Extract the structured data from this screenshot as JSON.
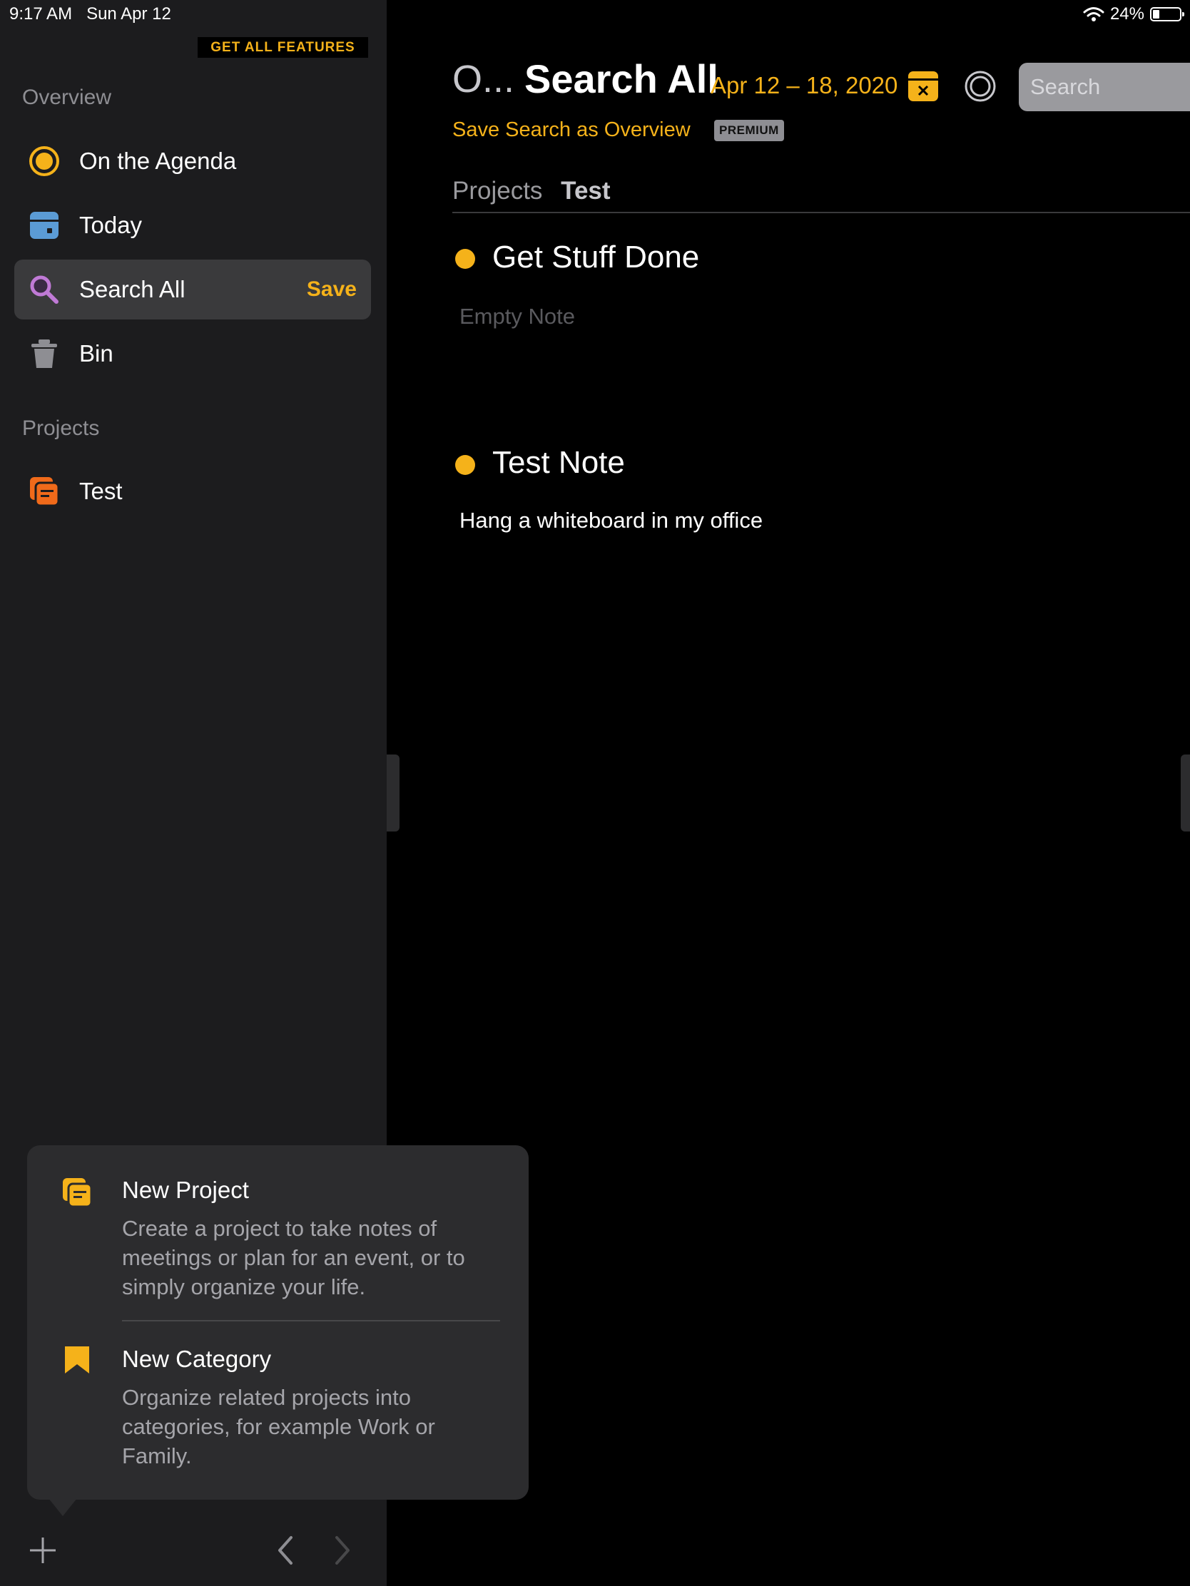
{
  "status_bar": {
    "time": "9:17 AM",
    "date": "Sun Apr 12",
    "battery": "24%"
  },
  "sidebar": {
    "get_features_label": "GET ALL FEATURES",
    "overview_header": "Overview",
    "overview_items": [
      {
        "label": "On the Agenda",
        "icon": "agenda-icon"
      },
      {
        "label": "Today",
        "icon": "today-calendar-icon"
      },
      {
        "label": "Search All",
        "icon": "search-icon",
        "action": "Save",
        "selected": true
      },
      {
        "label": "Bin",
        "icon": "trash-icon"
      }
    ],
    "projects_header": "Projects",
    "project_items": [
      {
        "label": "Test",
        "icon": "project-icon"
      }
    ]
  },
  "popover": {
    "items": [
      {
        "title": "New Project",
        "description": "Create a project to take notes of meetings or plan for an event, or to simply organize your life.",
        "icon": "project-icon"
      },
      {
        "title": "New Category",
        "description": "Organize related projects into categories, for example Work or Family.",
        "icon": "bookmark-icon"
      }
    ]
  },
  "toolbar": {
    "add_icon": "plus-icon",
    "back_icon": "chevron-left-icon",
    "forward_icon": "chevron-right-icon"
  },
  "main": {
    "breadcrumb": "O...",
    "title": "Search All",
    "date_range": "Apr 12 – 18, 2020",
    "search_placeholder": "Search",
    "save_search_label": "Save Search as Overview",
    "premium_badge": "PREMIUM",
    "tabs": [
      "Projects",
      "Test"
    ],
    "notes": [
      {
        "title": "Get Stuff Done",
        "body": "Empty Note",
        "empty": true
      },
      {
        "title": "Test Note",
        "body": "Hang a whiteboard in my office",
        "empty": false
      }
    ]
  },
  "colors": {
    "accent": "#f5b21a",
    "sidebar_bg": "#1c1c1e",
    "main_bg": "#000000",
    "popover_bg": "#2c2c2e",
    "project_orange": "#f06a1a",
    "today_blue": "#5b9bd5",
    "search_purple": "#c07ad6"
  }
}
